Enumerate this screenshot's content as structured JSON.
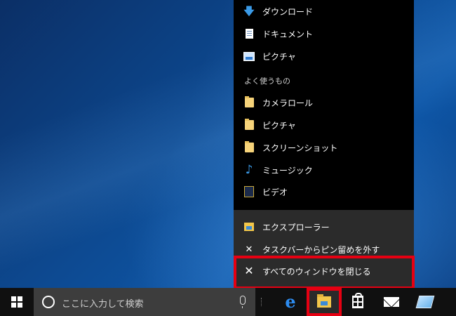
{
  "jumplist": {
    "items_top": [
      {
        "label": "ダウンロード",
        "icon": "download-icon"
      },
      {
        "label": "ドキュメント",
        "icon": "document-icon"
      },
      {
        "label": "ピクチャ",
        "icon": "picture-icon"
      }
    ],
    "frequent_header": "よく使うもの",
    "frequent": [
      {
        "label": "カメラロール",
        "icon": "folder-icon"
      },
      {
        "label": "ピクチャ",
        "icon": "folder-icon"
      },
      {
        "label": "スクリーンショット",
        "icon": "folder-icon"
      },
      {
        "label": "ミュージック",
        "icon": "music-icon"
      },
      {
        "label": "ビデオ",
        "icon": "video-icon"
      }
    ],
    "tasks": [
      {
        "label": "エクスプローラー",
        "icon": "file-explorer-icon"
      },
      {
        "label": "タスクバーからピン留めを外す",
        "icon": "unpin-icon"
      },
      {
        "label": "すべてのウィンドウを閉じる",
        "icon": "close-icon"
      }
    ]
  },
  "taskbar": {
    "search_placeholder": "ここに入力して検索",
    "apps": [
      "edge-icon",
      "file-explorer-icon",
      "store-icon",
      "mail-icon",
      "sticky-notes-icon"
    ]
  },
  "colors": {
    "highlight": "#e60012",
    "accent": "#76b9ed"
  }
}
